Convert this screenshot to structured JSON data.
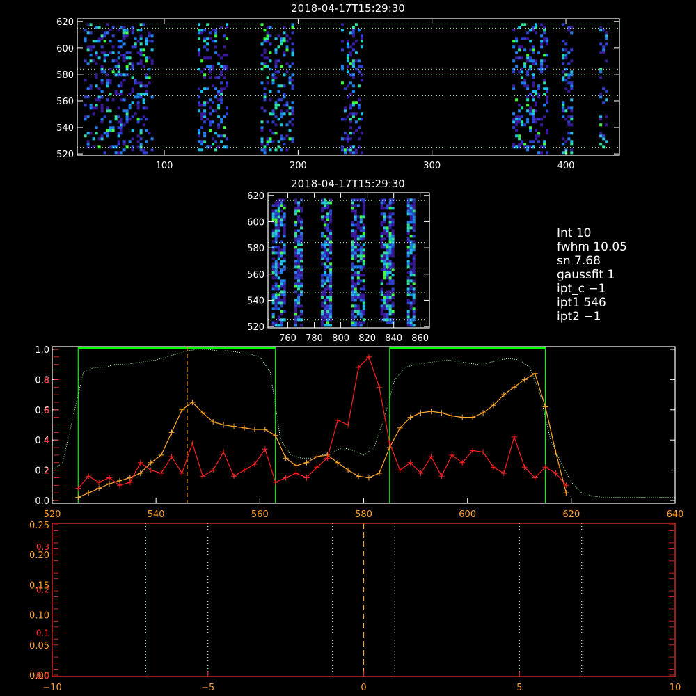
{
  "colors": {
    "axis": "#ffffff",
    "red_axis": "#ff3030",
    "orange_axis": "#ffa030",
    "green": "#00ff00",
    "light_green": "#a0ffa0",
    "red_series": "#ff2020",
    "orange_series": "#ffa830"
  },
  "info_panel": {
    "lines": [
      "Int      10",
      "fwhm   10.05",
      "sn       7.68",
      "gaussfit  1",
      "ipt_c   −1",
      "ipt1  546",
      "ipt2   −1"
    ]
  },
  "chart_data": [
    {
      "type": "heatmap",
      "title": "2018-04-17T15:29:30",
      "xlim": [
        35,
        440
      ],
      "ylim": [
        519,
        622
      ],
      "xticks": [
        100,
        200,
        300,
        400
      ],
      "yticks": [
        520,
        540,
        560,
        580,
        600,
        620
      ],
      "hlines": [
        525,
        564,
        580,
        584,
        615,
        618
      ],
      "bands": [
        [
          40,
          90
        ],
        [
          125,
          147
        ],
        [
          172,
          195
        ],
        [
          232,
          248
        ],
        [
          360,
          385
        ],
        [
          397,
          405
        ],
        [
          425,
          430
        ]
      ],
      "colormap": "rainbow-dark"
    },
    {
      "type": "heatmap",
      "title": "2018-04-17T15:29:30",
      "xlim": [
        745,
        867
      ],
      "ylim": [
        519,
        622
      ],
      "xticks": [
        760,
        780,
        800,
        820,
        840,
        860
      ],
      "yticks": [
        520,
        540,
        560,
        580,
        600,
        620
      ],
      "hlines": [
        525,
        546,
        564,
        584,
        616
      ],
      "bands": [
        [
          748,
          758
        ],
        [
          765,
          770
        ],
        [
          785,
          792
        ],
        [
          808,
          818
        ],
        [
          830,
          840
        ],
        [
          850,
          856
        ]
      ],
      "colormap": "rainbow-dark"
    },
    {
      "type": "line",
      "xlim": [
        520,
        640
      ],
      "ylim": [
        0,
        1
      ],
      "xticks": [
        520,
        540,
        560,
        580,
        600,
        620,
        640
      ],
      "yticks": [
        0.0,
        0.2,
        0.4,
        0.6,
        0.8,
        1.0
      ],
      "yticks_right_red": [
        "2",
        "4",
        "6",
        "8"
      ],
      "yticks_right_red_values": [
        2,
        4,
        6,
        8
      ],
      "y2lim": [
        0,
        10
      ],
      "vlines": [
        {
          "x": 525,
          "color": "green"
        },
        {
          "x": 563,
          "color": "green"
        },
        {
          "x": 585,
          "color": "green"
        },
        {
          "x": 615,
          "color": "green"
        },
        {
          "x": 546,
          "color": "orange",
          "dashed": true
        }
      ],
      "top_bars": [
        [
          525,
          563
        ],
        [
          585,
          615
        ]
      ],
      "series": [
        {
          "color": "light_green",
          "style": "dotted",
          "x": [
            520,
            522,
            524,
            526,
            528,
            530,
            532,
            534,
            536,
            538,
            540,
            542,
            544,
            546,
            548,
            550,
            552,
            554,
            556,
            558,
            560,
            562,
            564,
            566,
            568,
            570,
            572,
            574,
            576,
            578,
            580,
            582,
            584,
            586,
            588,
            590,
            592,
            594,
            596,
            598,
            600,
            602,
            604,
            606,
            608,
            610,
            612,
            614,
            616,
            618,
            620,
            622,
            624,
            626,
            628,
            630,
            632,
            634,
            636,
            638,
            640
          ],
          "y": [
            0.2,
            0.25,
            0.55,
            0.85,
            0.88,
            0.88,
            0.9,
            0.9,
            0.91,
            0.92,
            0.93,
            0.95,
            0.97,
            0.99,
            1.0,
            1.0,
            0.99,
            0.99,
            0.98,
            0.97,
            0.95,
            0.85,
            0.4,
            0.3,
            0.28,
            0.28,
            0.3,
            0.32,
            0.35,
            0.33,
            0.3,
            0.35,
            0.55,
            0.8,
            0.88,
            0.9,
            0.91,
            0.92,
            0.93,
            0.92,
            0.91,
            0.9,
            0.91,
            0.93,
            0.94,
            0.93,
            0.88,
            0.7,
            0.4,
            0.25,
            0.12,
            0.05,
            0.03,
            0.02,
            0.02,
            0.02,
            0.02,
            0.02,
            0.02,
            0.02,
            0.02
          ]
        },
        {
          "color": "orange_series",
          "style": "solid-plus",
          "x": [
            525,
            527,
            529,
            531,
            533,
            535,
            537,
            539,
            541,
            543,
            545,
            547,
            549,
            551,
            553,
            555,
            557,
            559,
            561,
            563,
            565,
            567,
            569,
            571,
            573,
            575,
            577,
            579,
            581,
            583,
            585,
            587,
            589,
            591,
            593,
            595,
            597,
            599,
            601,
            603,
            605,
            607,
            609,
            611,
            613,
            615,
            617,
            619
          ],
          "y": [
            0.02,
            0.05,
            0.08,
            0.11,
            0.13,
            0.15,
            0.18,
            0.25,
            0.3,
            0.45,
            0.6,
            0.65,
            0.58,
            0.52,
            0.5,
            0.49,
            0.48,
            0.47,
            0.47,
            0.43,
            0.28,
            0.23,
            0.25,
            0.29,
            0.3,
            0.25,
            0.2,
            0.16,
            0.15,
            0.18,
            0.35,
            0.48,
            0.55,
            0.58,
            0.59,
            0.58,
            0.56,
            0.55,
            0.55,
            0.58,
            0.63,
            0.7,
            0.75,
            0.8,
            0.84,
            0.62,
            0.32,
            0.05
          ]
        },
        {
          "color": "red_series",
          "style": "solid-plus",
          "axis": "right",
          "x": [
            525,
            527,
            529,
            531,
            533,
            535,
            537,
            539,
            541,
            543,
            545,
            547,
            549,
            551,
            553,
            555,
            557,
            559,
            561,
            563,
            565,
            567,
            569,
            571,
            573,
            575,
            577,
            579,
            581,
            583,
            585,
            587,
            589,
            591,
            593,
            595,
            597,
            599,
            601,
            603,
            605,
            607,
            609,
            611,
            613,
            615,
            617,
            619
          ],
          "y": [
            0.8,
            1.6,
            1.2,
            1.5,
            1.0,
            1.2,
            2.5,
            2.0,
            1.8,
            2.9,
            1.8,
            3.8,
            1.6,
            2.0,
            3.2,
            1.6,
            2.0,
            2.4,
            3.4,
            1.2,
            1.5,
            1.8,
            1.5,
            2.2,
            2.8,
            5.3,
            5.0,
            8.8,
            9.5,
            7.5,
            3.8,
            2.0,
            2.5,
            1.8,
            2.9,
            1.6,
            3.0,
            2.5,
            3.3,
            3.2,
            2.2,
            1.8,
            4.2,
            2.2,
            1.5,
            2.2,
            1.8,
            1.0
          ]
        }
      ]
    },
    {
      "type": "line",
      "xlim": [
        -10,
        10
      ],
      "xticks": [
        -10,
        -5,
        0,
        5,
        10
      ],
      "ylim": [
        0,
        0.25
      ],
      "yticks_left_orange": [
        "0.00",
        "0.05",
        "0.10",
        "0.15",
        "0.20",
        "0.25"
      ],
      "yticks_left_orange_values": [
        0,
        0.05,
        0.1,
        0.15,
        0.2,
        0.25
      ],
      "yticks_left_red": [
        "0.0",
        "0.1",
        "0.2",
        "0.3"
      ],
      "yticks_left_red_values": [
        0,
        0.1,
        0.2,
        0.3
      ],
      "y2lim": [
        0,
        0.35
      ],
      "vlines": [
        {
          "x": -7,
          "color": "light_green",
          "dotted": true
        },
        {
          "x": -5,
          "color": "light_green",
          "dotted": true
        },
        {
          "x": -1,
          "color": "light_green",
          "dotted": true
        },
        {
          "x": 1,
          "color": "light_green",
          "dotted": true
        },
        {
          "x": 5,
          "color": "light_green",
          "dotted": true
        },
        {
          "x": 7,
          "color": "light_green",
          "dotted": true
        },
        {
          "x": 0,
          "color": "orange",
          "dashed": true
        }
      ]
    }
  ]
}
